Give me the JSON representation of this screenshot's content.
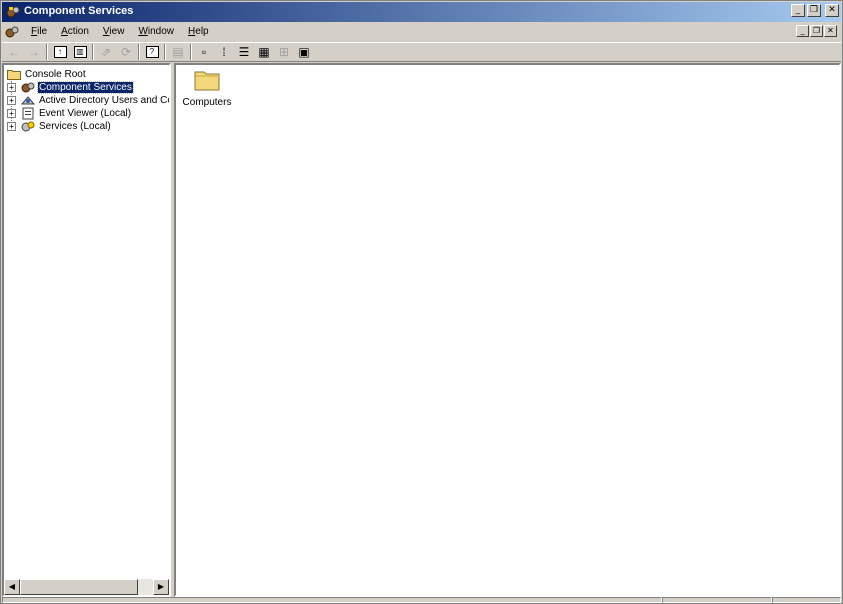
{
  "window": {
    "title": "Component Services",
    "caption_buttons": [
      "minimize",
      "maximize",
      "close"
    ]
  },
  "menubar": {
    "items": [
      {
        "label": "File",
        "accel": "F"
      },
      {
        "label": "Action",
        "accel": "A"
      },
      {
        "label": "View",
        "accel": "V"
      },
      {
        "label": "Window",
        "accel": "W"
      },
      {
        "label": "Help",
        "accel": "H"
      }
    ]
  },
  "toolbar": {
    "buttons": [
      "back-icon",
      "forward-icon",
      "up-one-level-icon",
      "show-hide-console-tree-icon",
      "export-list-icon",
      "refresh-icon",
      "help-icon",
      "new-window-icon",
      "large-icons-view-icon",
      "small-icons-view-icon",
      "list-view-icon",
      "detail-view-icon",
      "com-plus-view-icon",
      "status-view-icon"
    ]
  },
  "tree": {
    "root": "Console Root",
    "items": [
      {
        "label": "Component Services",
        "icon": "component-services-icon",
        "selected": true
      },
      {
        "label": "Active Directory Users and Comp",
        "icon": "active-directory-icon",
        "selected": false
      },
      {
        "label": "Event Viewer (Local)",
        "icon": "event-viewer-icon",
        "selected": false
      },
      {
        "label": "Services (Local)",
        "icon": "services-icon",
        "selected": false
      }
    ]
  },
  "results": {
    "items": [
      {
        "label": "Computers",
        "icon": "folder-icon"
      }
    ]
  },
  "colors": {
    "titlebar_start": "#0a246a",
    "titlebar_end": "#a6caf0",
    "selection": "#0a246a",
    "chrome": "#d4d0c8",
    "folder": "#f4d77a"
  }
}
